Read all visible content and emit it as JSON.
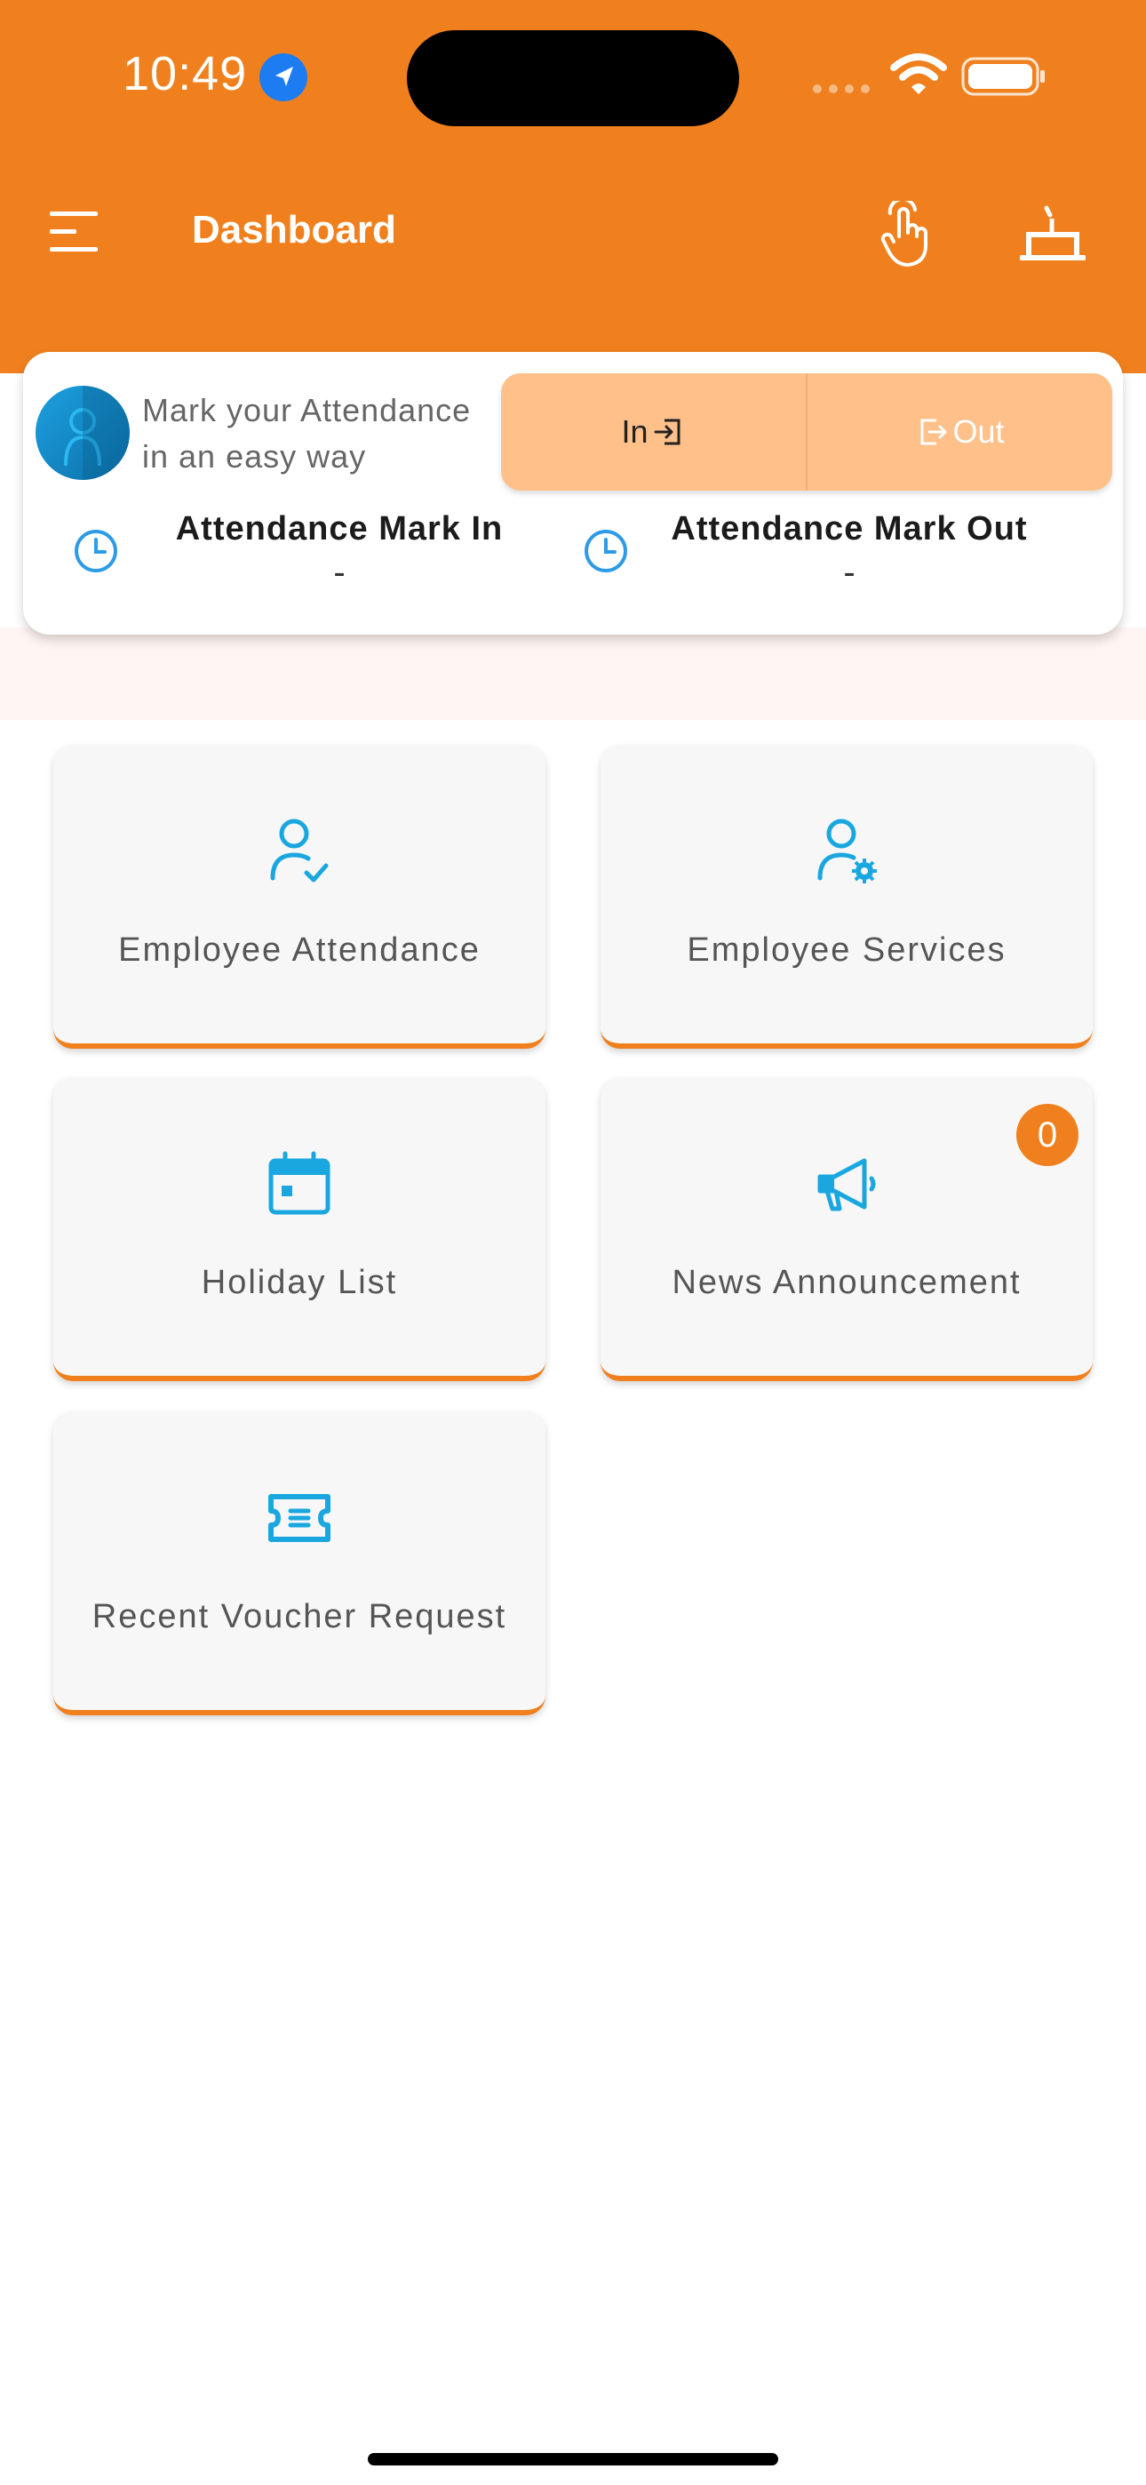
{
  "status_bar": {
    "time": "10:49"
  },
  "header": {
    "title": "Dashboard"
  },
  "attendance": {
    "tagline_line1": "Mark your Attendance",
    "tagline_line2": "in an easy way",
    "in_label": "In",
    "out_label": "Out",
    "mark_in_label": "Attendance Mark In",
    "mark_in_value": "-",
    "mark_out_label": "Attendance Mark Out",
    "mark_out_value": "-"
  },
  "tiles": [
    {
      "label": "Employee Attendance",
      "icon": "user-check-icon"
    },
    {
      "label": "Employee Services",
      "icon": "user-gear-icon"
    },
    {
      "label": "Holiday List",
      "icon": "calendar-icon"
    },
    {
      "label": "News Announcement",
      "icon": "megaphone-icon",
      "badge": "0"
    },
    {
      "label": "Recent Voucher Request",
      "icon": "ticket-icon"
    }
  ],
  "colors": {
    "brand": "#F0801E",
    "icon_blue": "#1AA7E0",
    "toggle_bg": "#FFC089"
  }
}
